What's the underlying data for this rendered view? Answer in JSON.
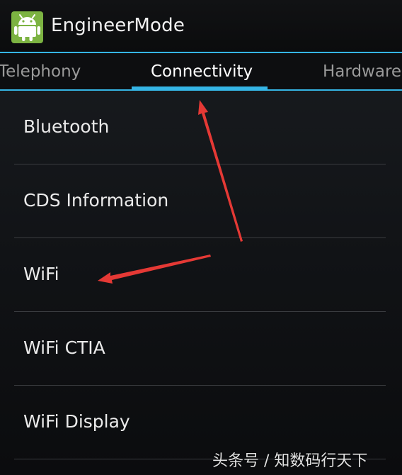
{
  "app": {
    "title": "EngineerMode",
    "icon": "android-robot-icon",
    "icon_color": "#7cb342"
  },
  "colors": {
    "accent": "#35b5e5",
    "annotation": "#e53935"
  },
  "tabs": {
    "items": [
      {
        "label": "Telephony",
        "selected": false
      },
      {
        "label": "Connectivity",
        "selected": true
      },
      {
        "label": "Hardware",
        "selected": false
      }
    ]
  },
  "list": {
    "items": [
      {
        "label": "Bluetooth"
      },
      {
        "label": "CDS Information"
      },
      {
        "label": "WiFi"
      },
      {
        "label": "WiFi CTIA"
      },
      {
        "label": "WiFi Display"
      }
    ]
  },
  "watermark": {
    "text": "头条号 / 知数码行天下"
  }
}
